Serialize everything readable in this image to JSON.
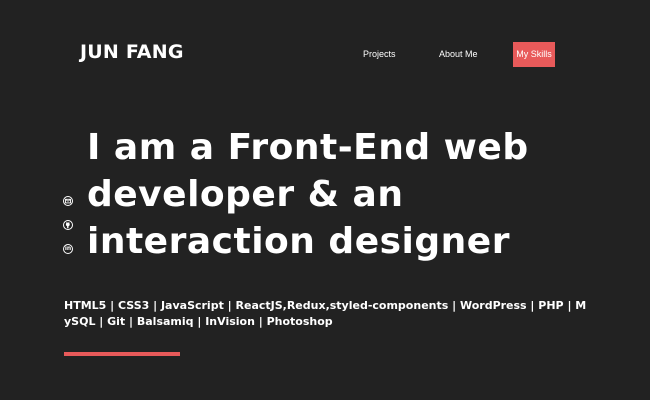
{
  "brand": {
    "name": "JUN FANG"
  },
  "nav": {
    "items": [
      {
        "label": "Projects"
      },
      {
        "label": "About Me"
      },
      {
        "label": "My Skills",
        "active": true
      }
    ]
  },
  "hero": {
    "headline_lines": [
      "I am a Front-End web",
      "developer & an",
      "interaction designer"
    ]
  },
  "social": {
    "icons": [
      "email-icon",
      "github-icon",
      "linkedin-icon"
    ],
    "linkedin_glyph": "in"
  },
  "skills": {
    "text": "HTML5 | CSS3 | JavaScript | ReactJS,Redux,styled-components | WordPress | PHP | MySQL | Git | Balsamiq | InVision | Photoshop"
  },
  "colors": {
    "background": "#222222",
    "text": "#ffffff",
    "accent": "#e85a5a"
  }
}
